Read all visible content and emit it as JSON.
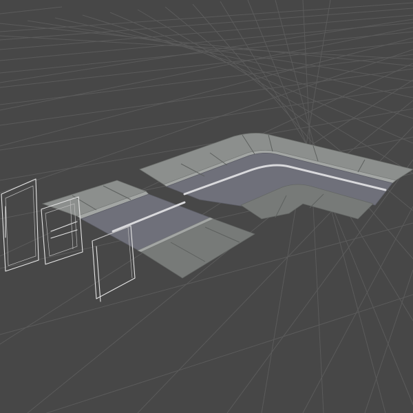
{
  "scene": {
    "background_color": "#474747",
    "grid_color": "#5b5b5b",
    "road_color": "#6f707a",
    "sidewalk_color": "#8c8f8d",
    "lane_line_color": "#d9d9dc",
    "wireframe_color": "#e6e6e6",
    "objects": [
      "road-corner-tile",
      "road-straight-tile",
      "wireframe-frame-1",
      "wireframe-frame-2",
      "wireframe-frame-3"
    ]
  }
}
